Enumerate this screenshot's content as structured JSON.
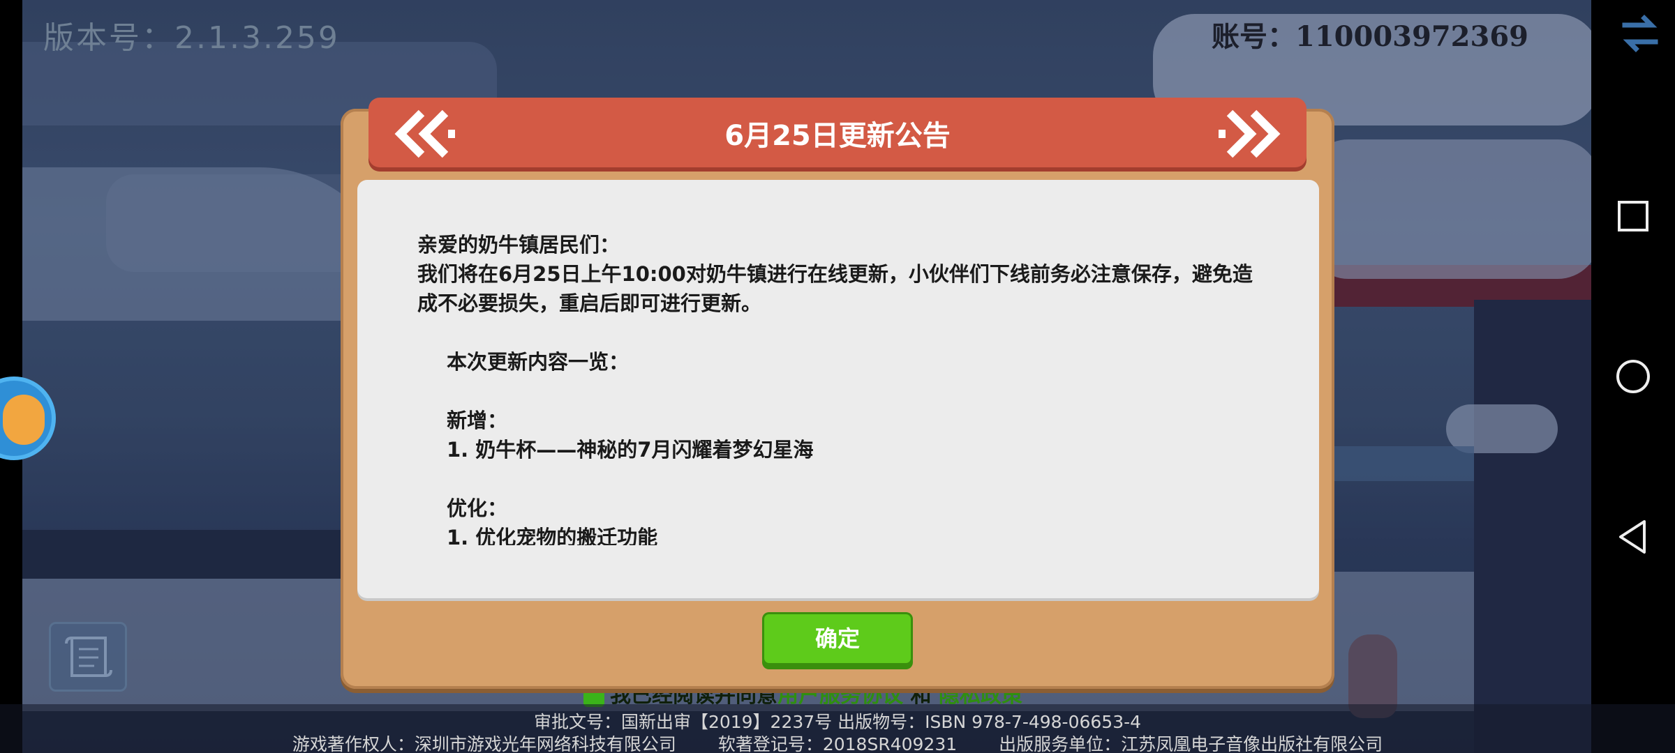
{
  "hud": {
    "version": "版本号：2.1.3.259",
    "account": "账号：110003972369"
  },
  "dialog": {
    "title": "6月25日更新公告",
    "greeting": "亲爱的奶牛镇居民们：",
    "intro": "我们将在6月25日上午10:00对奶牛镇进行在线更新，小伙伴们下线前务必注意保存，避免造成不必要损失，重启后即可进行更新。",
    "overview": "本次更新内容一览：",
    "new_heading": "新增：",
    "new_item_1": "1. 奶牛杯——神秘的7月闪耀着梦幻星海",
    "opt_heading": "优化：",
    "opt_item_1": "1. 优化宠物的搬迁功能",
    "confirm_label": "确定"
  },
  "agreement": {
    "prefix": "我已经阅读并同意",
    "user_agreement": "用户服务协议",
    "and": "和",
    "privacy": "隐私政策"
  },
  "footer": {
    "line1": "审批文号：国新出审【2019】2237号    出版物号：ISBN 978-7-498-06653-4",
    "copyright": "游戏著作权人：深圳市游戏光年网络科技有限公司",
    "software_reg": "软著登记号：2018SR409231",
    "publisher": "出版服务单位：江苏凤凰电子音像出版社有限公司"
  },
  "icons": {
    "swap": "swap-arrows-icon",
    "gamepad": "gamepad-icon",
    "scroll": "scroll-icon",
    "nav_square": "recent-apps-icon",
    "nav_circle": "home-icon",
    "nav_back": "back-icon"
  },
  "colors": {
    "ribbon": "#d35a45",
    "frame": "#d6a06a",
    "confirm": "#5ecb1b"
  }
}
